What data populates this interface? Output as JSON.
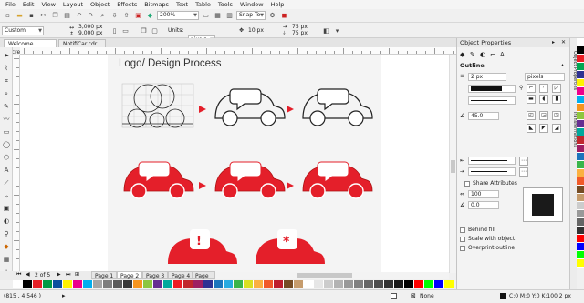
{
  "menu": [
    "File",
    "Edit",
    "View",
    "Layout",
    "Object",
    "Effects",
    "Bitmaps",
    "Text",
    "Table",
    "Tools",
    "Window",
    "Help"
  ],
  "toolbar1": {
    "zoom": "200%",
    "snap": "Snap To"
  },
  "toolbar2": {
    "preset": "Custom",
    "width": "3,000 px",
    "height": "9,000 px",
    "units_label": "Units:",
    "units": "pixels",
    "nudge": "10 px",
    "dup_x": "75 px",
    "dup_y": "75 px"
  },
  "tabs": [
    "Welcome Screen",
    "NotifiCar.cdr"
  ],
  "canvas": {
    "title": "Logo/ Design Process",
    "icon_marks": [
      "!",
      "*"
    ]
  },
  "pagenav": {
    "count": "2 of 5",
    "pages": [
      "Page 1",
      "Page 2",
      "Page 3",
      "Page 4",
      "Page 5"
    ]
  },
  "status": {
    "coords": "(815 , 4,546 )",
    "fill_label": "None",
    "outline": "C:0 M:0 Y:0 K:100  2 px"
  },
  "docker": {
    "title": "Object Properties",
    "section": "Outline",
    "width": "2 px",
    "units": "pixels",
    "angle": "45.0",
    "share_attributes": "Share Attributes",
    "stretch": "100",
    "nib_angle": "0.0",
    "behind_fill": "Behind fill",
    "scale_with_object": "Scale with object",
    "overprint": "Overprint outline"
  },
  "sidetabs": [
    "Object Properties",
    "Transformations"
  ],
  "colors": {
    "accent": "#e41f2a",
    "palette_bottom": [
      "#ffffff",
      "#000000",
      "#e51e26",
      "#009a44",
      "#0b4f9e",
      "#fff200",
      "#ec008c",
      "#00aeef",
      "#a4a4a4",
      "#7d7d7d",
      "#5a5a5a",
      "#383838",
      "#f7941d",
      "#8dc63f",
      "#662d91",
      "#00a99d",
      "#ed1c24",
      "#c1272d",
      "#9e1f63",
      "#2e3192",
      "#1b75bc",
      "#27aae1",
      "#39b54a",
      "#d9e021",
      "#fbb040",
      "#f15a29",
      "#be1e2d",
      "#754c24",
      "#c69c6d",
      "#ffffff",
      "#e6e6e6",
      "#cccccc",
      "#b3b3b3",
      "#999999",
      "#808080",
      "#666666",
      "#4d4d4d",
      "#333333",
      "#1a1a1a",
      "#000000",
      "#ff0000",
      "#00ff00",
      "#0000ff",
      "#ffff00"
    ],
    "palette_right": [
      "#ffffff",
      "#000000",
      "#ed1c24",
      "#00a651",
      "#2e3192",
      "#fff200",
      "#ec008c",
      "#00aeef",
      "#f7941d",
      "#8dc63f",
      "#662d91",
      "#00a99d",
      "#c1272d",
      "#9e1f63",
      "#1b75bc",
      "#39b54a",
      "#fbb040",
      "#f15a29",
      "#754c24",
      "#c69c6d",
      "#cccccc",
      "#999999",
      "#666666",
      "#333333",
      "#ff0000",
      "#0000ff",
      "#00ff00",
      "#ffff00"
    ]
  }
}
